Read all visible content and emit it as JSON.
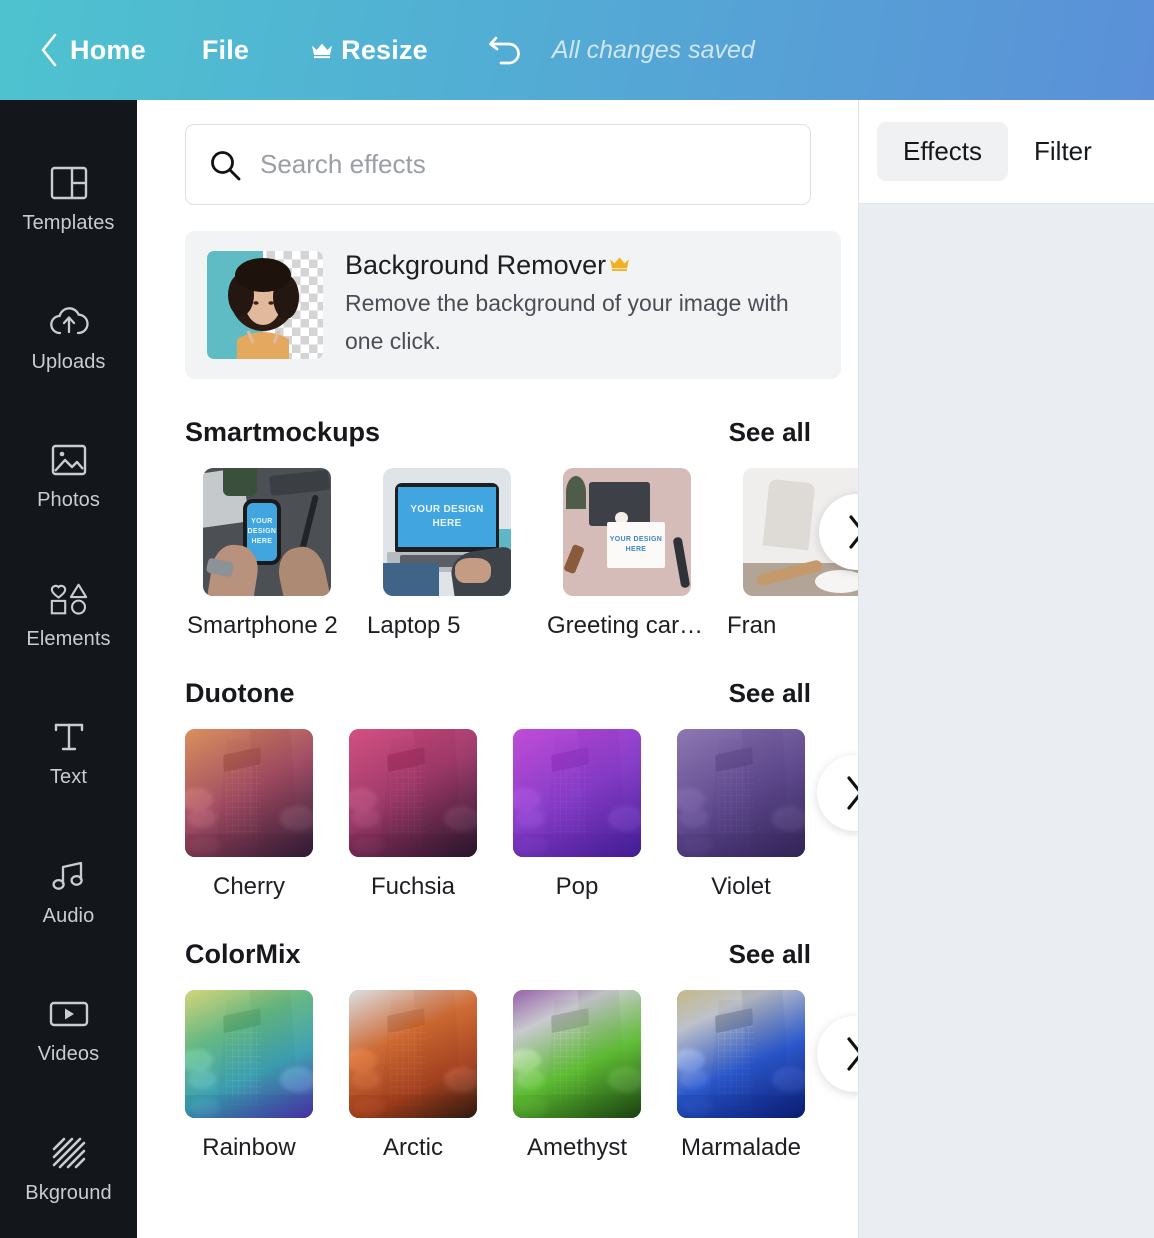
{
  "topbar": {
    "back_icon": "chevron-left-icon",
    "home": "Home",
    "file": "File",
    "crown_icon": "crown-icon",
    "resize": "Resize",
    "undo_icon": "undo-icon",
    "status": "All changes saved",
    "gradient_from": "#4ec3cf",
    "gradient_to": "#5b90d8"
  },
  "sidebar": {
    "background": "#13161b",
    "items": [
      {
        "label": "Templates",
        "icon": "templates-icon"
      },
      {
        "label": "Uploads",
        "icon": "upload-cloud-icon"
      },
      {
        "label": "Photos",
        "icon": "photo-icon"
      },
      {
        "label": "Elements",
        "icon": "shapes-icon"
      },
      {
        "label": "Text",
        "icon": "text-icon"
      },
      {
        "label": "Audio",
        "icon": "music-note-icon"
      },
      {
        "label": "Videos",
        "icon": "video-icon"
      },
      {
        "label": "Bkground",
        "icon": "hatch-pattern-icon"
      }
    ]
  },
  "search": {
    "placeholder": "Search effects",
    "icon": "search-icon"
  },
  "background_remover": {
    "title": "Background Remover",
    "crown_icon": "crown-icon",
    "crown_color": "#f2b01e",
    "description": "Remove the background of your image with one click.",
    "thumb": "portrait-with-transparency-thumbnail"
  },
  "sections": [
    {
      "title": "Smartmockups",
      "see_all": "See all",
      "kind": "mockups",
      "next_icon": "chevron-right-icon",
      "tiles": [
        {
          "label": "Smartphone 2",
          "art": "phone-on-desk",
          "overlay": "YOUR DESIGN HERE"
        },
        {
          "label": "Laptop 5",
          "art": "laptop",
          "overlay": "YOUR DESIGN HERE"
        },
        {
          "label": "Greeting car…",
          "art": "greeting-card",
          "overlay": "YOUR DESIGN HERE"
        },
        {
          "label": "Fran",
          "art": "frame",
          "overlay": ""
        }
      ]
    },
    {
      "title": "Duotone",
      "see_all": "See all",
      "kind": "duotone",
      "next_icon": "chevron-right-icon",
      "tiles": [
        {
          "label": "Cherry",
          "wash": "linear-gradient(150deg, rgba(236,140,70,.78) 0%, rgba(176,70,96,.80) 48%, rgba(48,26,54,.90) 100%)"
        },
        {
          "label": "Fuchsia",
          "wash": "linear-gradient(150deg, rgba(226,60,120,.80) 0%, rgba(170,48,104,.82) 46%, rgba(40,22,44,.92) 100%)"
        },
        {
          "label": "Pop",
          "wash": "linear-gradient(150deg, rgba(200,60,224,.84) 0%, rgba(140,54,214,.86) 50%, rgba(70,30,160,.90) 100%)"
        },
        {
          "label": "Violet",
          "wash": "linear-gradient(150deg, rgba(140,110,180,.80) 0%, rgba(96,70,150,.84) 50%, rgba(52,36,92,.92) 100%)"
        }
      ]
    },
    {
      "title": "ColorMix",
      "see_all": "See all",
      "kind": "colormix",
      "next_icon": "chevron-right-icon",
      "tiles": [
        {
          "label": "Rainbow",
          "wash": "linear-gradient(155deg, rgba(226,226,110,.80) 0%, rgba(96,200,130,.78) 32%, rgba(56,180,200,.78) 62%, rgba(78,52,190,.84) 100%)"
        },
        {
          "label": "Arctic",
          "wash": "linear-gradient(155deg, rgba(250,250,250,.70) 0%, rgba(226,104,36,.82) 38%, rgba(180,64,24,.84) 70%, rgba(48,26,14,.90) 100%)"
        },
        {
          "label": "Amethyst",
          "wash": "linear-gradient(155deg, rgba(150,70,170,.72) 0%, rgba(244,244,244,.62) 24%, rgba(96,206,44,.84) 58%, rgba(26,70,16,.88) 100%)"
        },
        {
          "label": "Marmalade",
          "wash": "linear-gradient(155deg, rgba(226,200,110,.60) 0%, rgba(236,240,248,.55) 22%, rgba(34,86,220,.84) 58%, rgba(10,28,120,.92) 100%)"
        }
      ]
    }
  ],
  "right_panel": {
    "tabs": [
      {
        "label": "Effects",
        "active": true
      },
      {
        "label": "Filter",
        "active": false
      }
    ],
    "background": "#eaedf1"
  }
}
